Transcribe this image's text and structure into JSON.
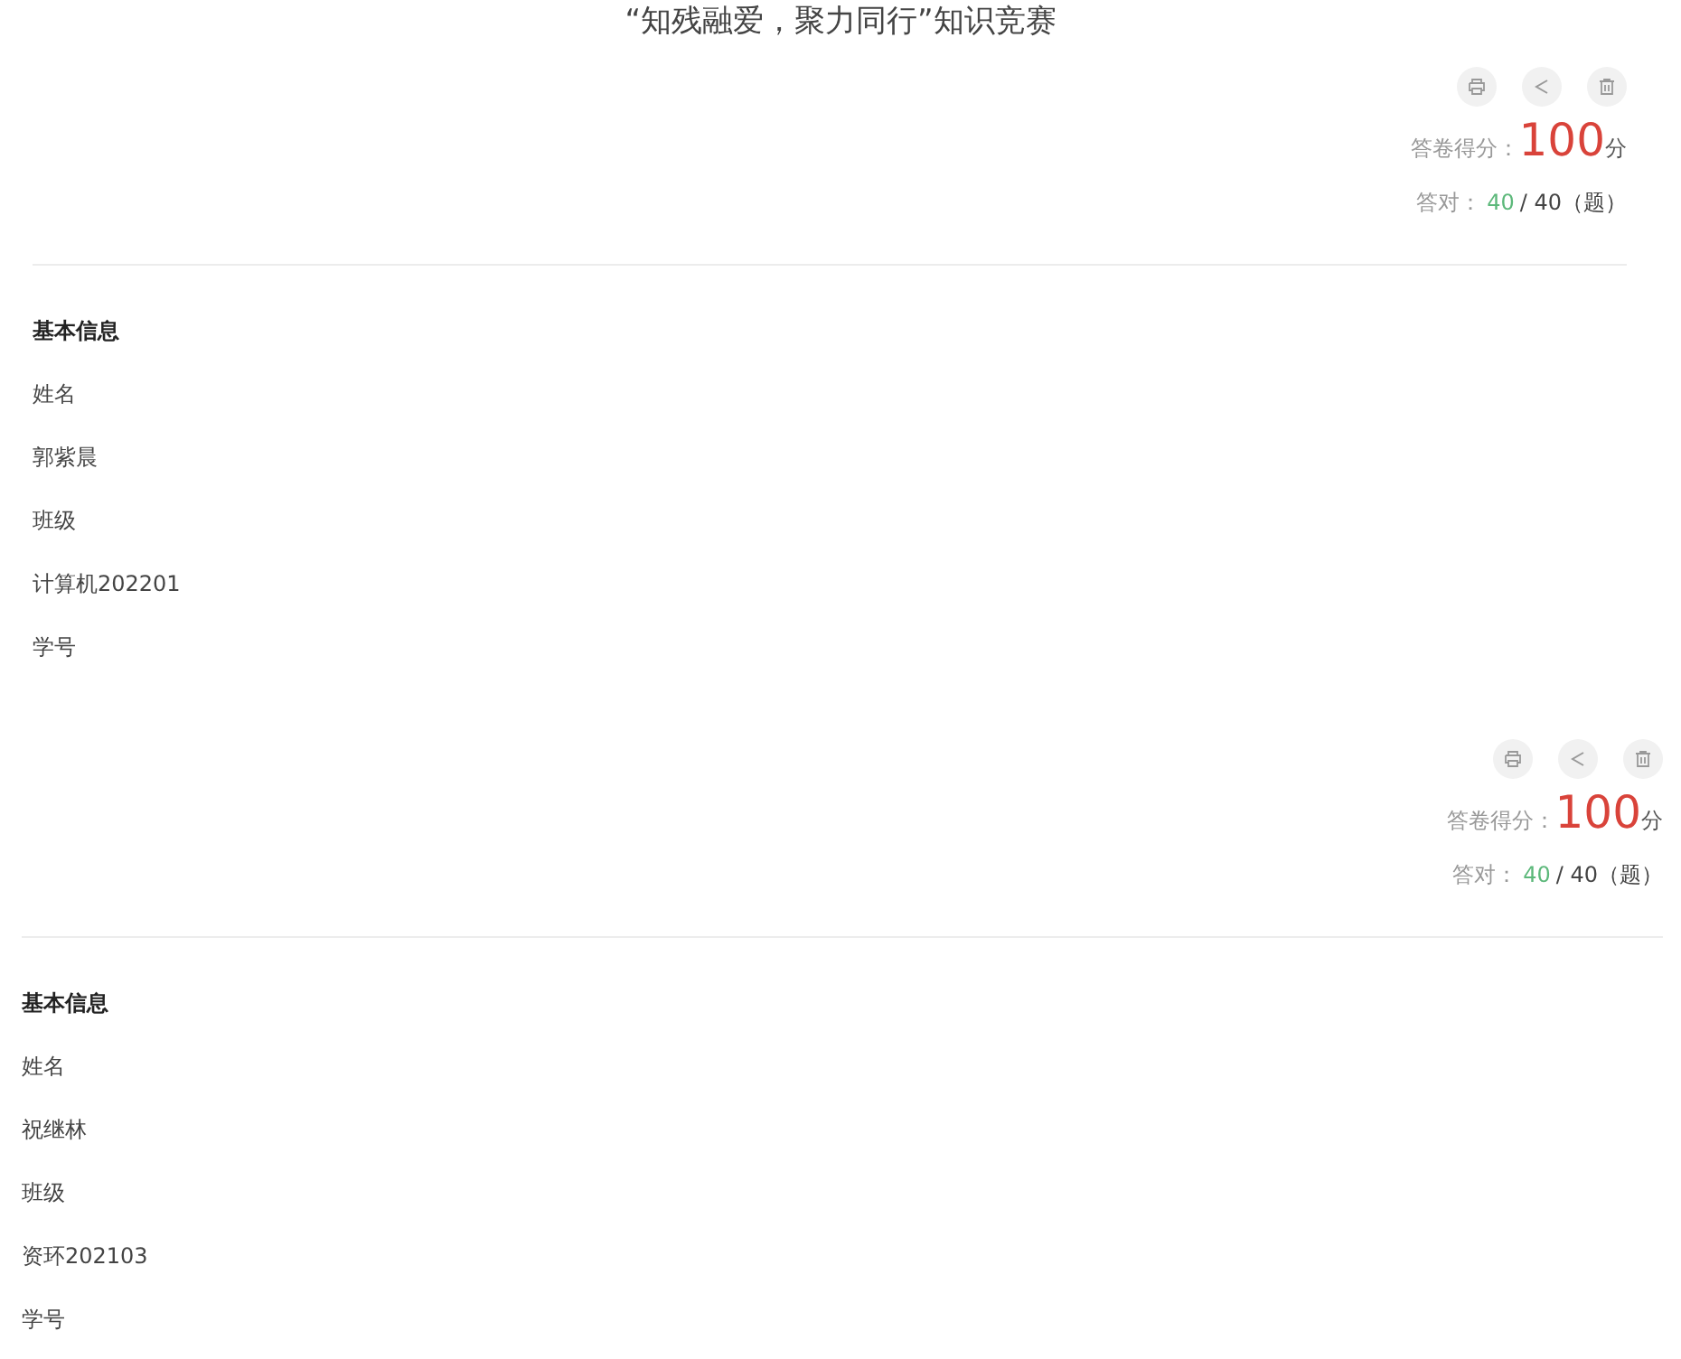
{
  "records": [
    {
      "title": "“知残融爱，聚力同行”知识竞赛",
      "score_label": "答卷得分：",
      "score": "100",
      "score_unit": "分",
      "correct_label": "答对：",
      "correct": "40",
      "total": "/ 40（题）",
      "section": "基本信息",
      "fields": [
        {
          "label": "姓名",
          "value": "郭紫晨"
        },
        {
          "label": "班级",
          "value": "计算机202201"
        },
        {
          "label": "学号"
        }
      ]
    },
    {
      "score_label": "答卷得分：",
      "score": "100",
      "score_unit": "分",
      "correct_label": "答对：",
      "correct": "40",
      "total": "/ 40（题）",
      "section": "基本信息",
      "fields": [
        {
          "label": "姓名",
          "value": "祝继林"
        },
        {
          "label": "班级",
          "value": "资环202103"
        },
        {
          "label": "学号"
        }
      ]
    }
  ]
}
